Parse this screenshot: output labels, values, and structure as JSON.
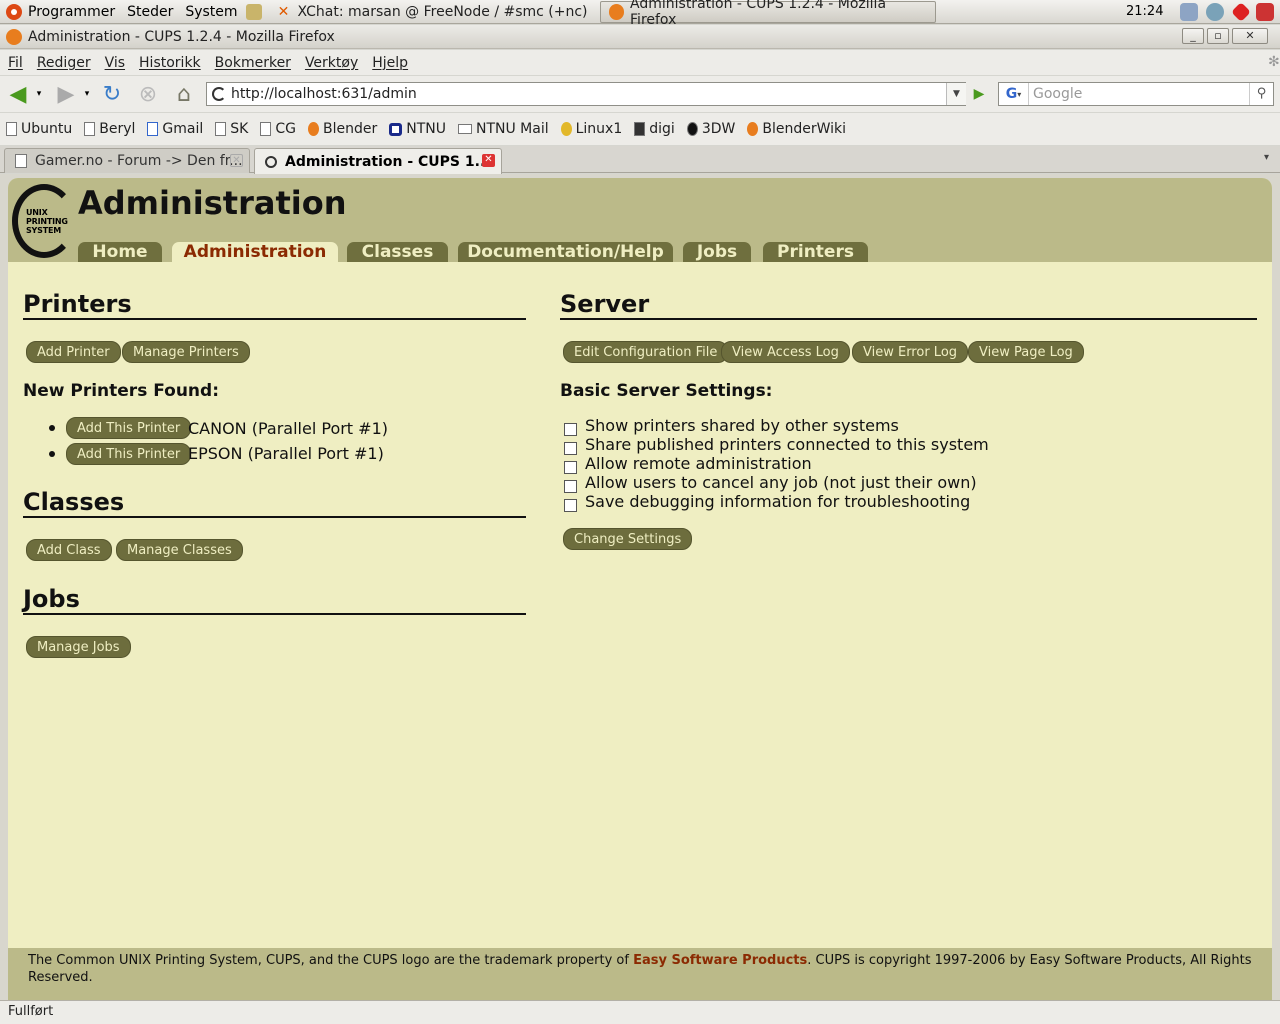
{
  "panel": {
    "applications": "Programmer",
    "places": "Steder",
    "system": "System",
    "clock": "21:24",
    "tasks": [
      {
        "label": "XChat: marsan @ FreeNode / #smc (+nc)"
      },
      {
        "label": "Administration - CUPS 1.2.4 - Mozilla Firefox"
      }
    ]
  },
  "window": {
    "title": "Administration - CUPS 1.2.4 - Mozilla Firefox"
  },
  "menu": [
    "Fil",
    "Rediger",
    "Vis",
    "Historikk",
    "Bokmerker",
    "Verktøy",
    "Hjelp"
  ],
  "nav": {
    "url": "http://localhost:631/admin",
    "search_placeholder": "Google",
    "search_engine": "G"
  },
  "bookmarks": [
    "Ubuntu",
    "Beryl",
    "Gmail",
    "SK",
    "CG",
    "Blender",
    "NTNU",
    "NTNU Mail",
    "Linux1",
    "digi",
    "3DW",
    "BlenderWiki"
  ],
  "tabs": [
    {
      "label": "Gamer.no - Forum -> Den fr..."
    },
    {
      "label": "Administration - CUPS 1...."
    }
  ],
  "cups": {
    "page_title": "Administration",
    "logo_text": "UNIX PRINTING SYSTEM",
    "nav": [
      "Home",
      "Administration",
      "Classes",
      "Documentation/Help",
      "Jobs",
      "Printers"
    ],
    "printers": {
      "heading": "Printers",
      "add": "Add Printer",
      "manage": "Manage Printers",
      "new_found": "New Printers Found:",
      "found": [
        {
          "button": "Add This Printer",
          "name": "CANON (Parallel Port #1)"
        },
        {
          "button": "Add This Printer",
          "name": "EPSON (Parallel Port #1)"
        }
      ]
    },
    "classes": {
      "heading": "Classes",
      "add": "Add Class",
      "manage": "Manage Classes"
    },
    "jobs": {
      "heading": "Jobs",
      "manage": "Manage Jobs"
    },
    "server": {
      "heading": "Server",
      "buttons": [
        "Edit Configuration File",
        "View Access Log",
        "View Error Log",
        "View Page Log"
      ],
      "basic": "Basic Server Settings:",
      "options": [
        "Show printers shared by other systems",
        "Share published printers connected to this system",
        "Allow remote administration",
        "Allow users to cancel any job (not just their own)",
        "Save debugging information for troubleshooting"
      ],
      "change": "Change Settings"
    },
    "footer": {
      "pre": "The Common UNIX Printing System, CUPS, and the CUPS logo are the trademark property of ",
      "link": "Easy Software Products",
      "post": ". CUPS is copyright 1997-2006 by Easy Software Products, All Rights Reserved."
    }
  },
  "status": "Fullført"
}
